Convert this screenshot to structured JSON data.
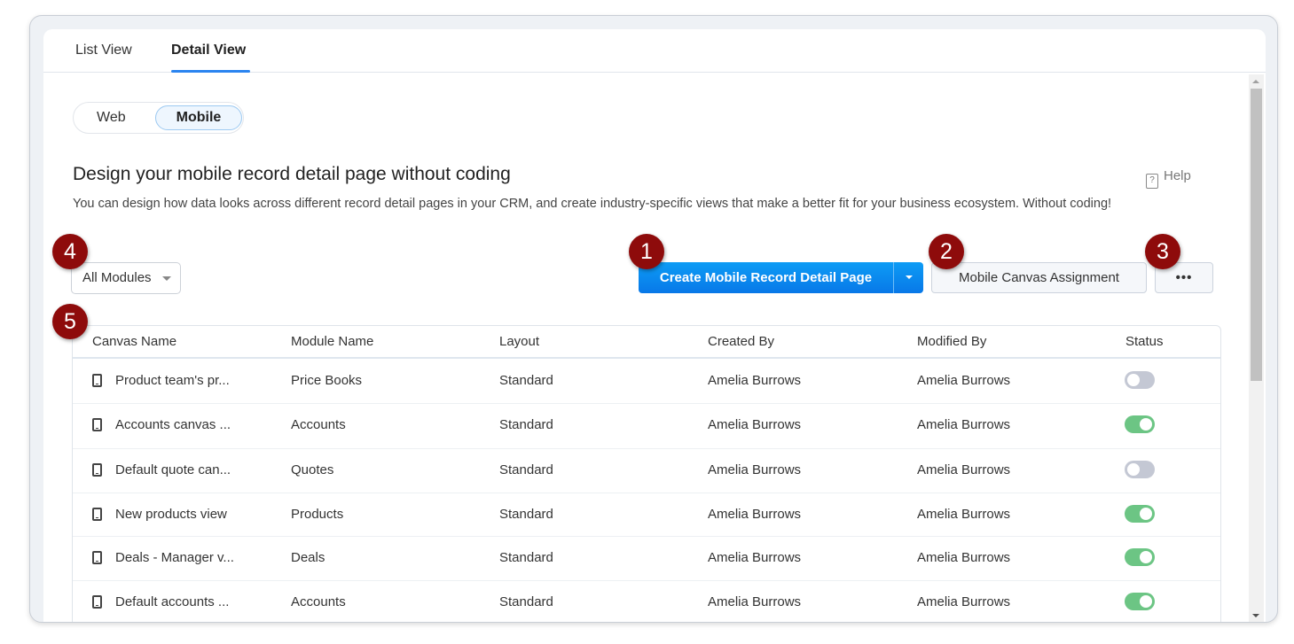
{
  "tabs": [
    {
      "label": "List View"
    },
    {
      "label": "Detail View",
      "active": true
    }
  ],
  "segment": {
    "web": "Web",
    "mobile": "Mobile",
    "selected": "Mobile"
  },
  "title": "Design your mobile record detail page without coding",
  "description": "You can design how data looks across different record detail pages in your CRM, and create industry-specific views that make a better fit for your business ecosystem. Without coding!",
  "help": "Help",
  "filter": {
    "value": "All Modules"
  },
  "buttons": {
    "create": "Create Mobile Record Detail Page",
    "assignment": "Mobile Canvas Assignment",
    "more": "•••"
  },
  "badges": [
    "1",
    "2",
    "3",
    "4",
    "5"
  ],
  "table": {
    "columns": [
      "Canvas Name",
      "Module Name",
      "Layout",
      "Created By",
      "Modified By",
      "Status"
    ],
    "rows": [
      {
        "name": "Product team's pr...",
        "module": "Price Books",
        "layout": "Standard",
        "created": "Amelia Burrows",
        "modified": "Amelia Burrows",
        "status": false
      },
      {
        "name": "Accounts canvas ...",
        "module": "Accounts",
        "layout": "Standard",
        "created": "Amelia Burrows",
        "modified": "Amelia Burrows",
        "status": true
      },
      {
        "name": "Default quote can...",
        "module": "Quotes",
        "layout": "Standard",
        "created": "Amelia Burrows",
        "modified": "Amelia Burrows",
        "status": false
      },
      {
        "name": "New products view",
        "module": "Products",
        "layout": "Standard",
        "created": "Amelia Burrows",
        "modified": "Amelia Burrows",
        "status": true
      },
      {
        "name": "Deals - Manager v...",
        "module": "Deals",
        "layout": "Standard",
        "created": "Amelia Burrows",
        "modified": "Amelia Burrows",
        "status": true
      },
      {
        "name": "Default accounts ...",
        "module": "Accounts",
        "layout": "Standard",
        "created": "Amelia Burrows",
        "modified": "Amelia Burrows",
        "status": true
      }
    ]
  },
  "colors": {
    "primary": "#0878e8",
    "toggle_on": "#6cc584",
    "toggle_off": "#c4c8d4",
    "badge": "#8e0b0b"
  }
}
